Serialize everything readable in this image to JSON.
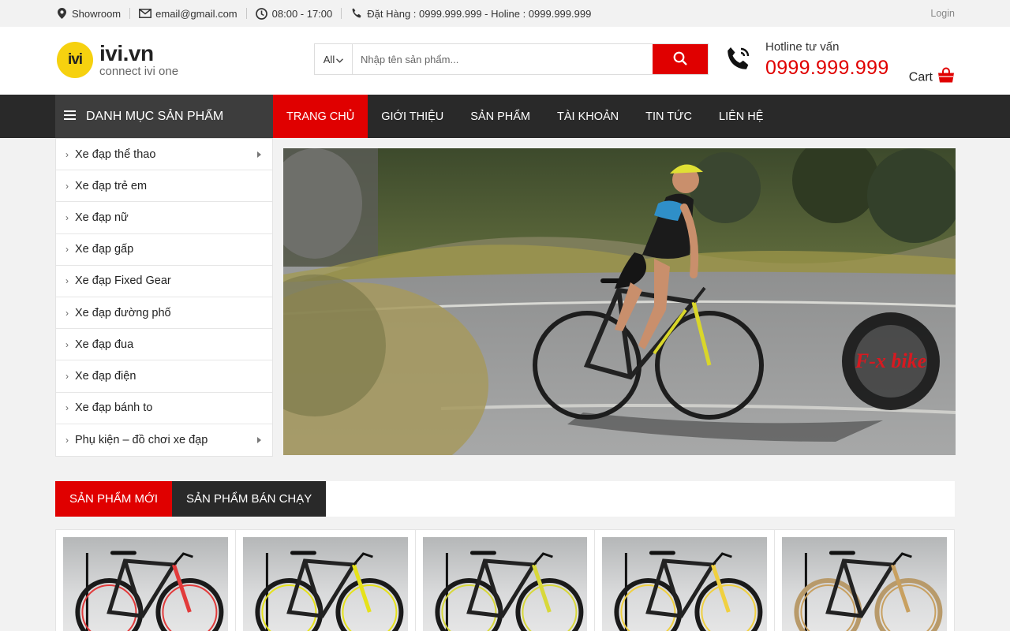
{
  "topbar": {
    "showroom": "Showroom",
    "email": "email@gmail.com",
    "hours": "08:00 - 17:00",
    "order_phone": "Đặt Hàng : 0999.999.999 - Holine : 0999.999.999",
    "login": "Login"
  },
  "header": {
    "logo_badge": "ivi",
    "logo_main": "ivi.vn",
    "logo_sub": "connect ivi one",
    "search_category": "All",
    "search_placeholder": "Nhập tên sản phẩm...",
    "hotline_label": "Hotline tư vấn",
    "hotline_number": "0999.999.999",
    "cart_label": "Cart"
  },
  "nav": {
    "category_heading": "DANH MỤC SẢN PHẨM",
    "links": [
      {
        "label": "TRANG CHỦ"
      },
      {
        "label": "GIỚI THIỆU"
      },
      {
        "label": "SẢN PHẨM"
      },
      {
        "label": "TÀI KHOẢN"
      },
      {
        "label": "TIN TỨC"
      },
      {
        "label": "LIÊN HỆ"
      }
    ]
  },
  "categories": [
    {
      "label": "Xe đạp thể thao",
      "has_submenu": true
    },
    {
      "label": "Xe đạp trẻ em",
      "has_submenu": false
    },
    {
      "label": "Xe đạp nữ",
      "has_submenu": false
    },
    {
      "label": "Xe đạp gấp",
      "has_submenu": false
    },
    {
      "label": "Xe đạp Fixed Gear",
      "has_submenu": false
    },
    {
      "label": "Xe đạp đường phố",
      "has_submenu": false
    },
    {
      "label": "Xe đạp đua",
      "has_submenu": false
    },
    {
      "label": "Xe đạp điện",
      "has_submenu": false
    },
    {
      "label": "Xe đạp bánh to",
      "has_submenu": false
    },
    {
      "label": "Phụ kiện – đồ chơi xe đạp",
      "has_submenu": true
    }
  ],
  "banner": {
    "brand": "F-x bike"
  },
  "tabs": [
    {
      "label": "SẢN PHẨM MỚI"
    },
    {
      "label": "SẢN PHẨM BÁN CHẠY"
    }
  ],
  "products": [
    {
      "accent": "#e23b3b"
    },
    {
      "accent": "#e6e21a"
    },
    {
      "accent": "#d8d83a"
    },
    {
      "accent": "#f0d040"
    },
    {
      "accent": "#c8a060"
    }
  ],
  "colors": {
    "accent": "#e00000",
    "dark": "#292929",
    "logo_yellow": "#f6d10f"
  }
}
